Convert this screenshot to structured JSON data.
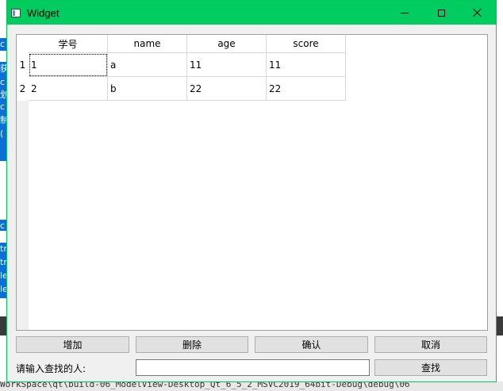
{
  "window": {
    "title": "Widget"
  },
  "table": {
    "columns": [
      "学号",
      "name",
      "age",
      "score"
    ],
    "row_headers": [
      "1",
      "2"
    ],
    "rows": [
      [
        "1",
        "a",
        "11",
        "11"
      ],
      [
        "2",
        "b",
        "22",
        "22"
      ]
    ]
  },
  "buttons": {
    "add": "增加",
    "delete": "删除",
    "confirm": "确认",
    "cancel": "取消",
    "search": "查找"
  },
  "search": {
    "label": "请输入查找的人:",
    "value": ""
  },
  "background": {
    "left_glyphs": [
      "c",
      "获",
      "c",
      "划",
      "c",
      "制",
      "(",
      "c",
      "tr",
      "tr",
      "le",
      "le"
    ],
    "bottom_text": "WorkSpace\\qt\\build-06_ModelView-Desktop_Qt_6_5_2_MSVC2019_64bit-Debug\\debug\\06"
  }
}
